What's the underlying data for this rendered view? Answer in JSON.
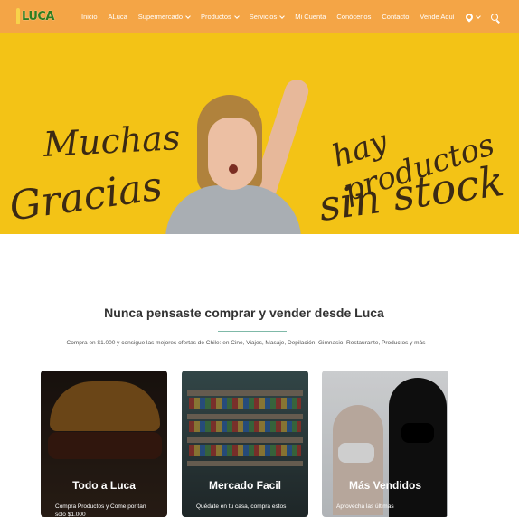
{
  "header": {
    "logo_text": "LUCA",
    "menu": [
      {
        "label": "Inicio"
      },
      {
        "label": "ALuca"
      },
      {
        "label": "Supermercado"
      },
      {
        "label": "Productos"
      },
      {
        "label": "Servicios"
      },
      {
        "label": "Mi Cuenta"
      },
      {
        "label": "Conócenos"
      },
      {
        "label": "Contacto"
      },
      {
        "label": "Vende Aquí"
      }
    ]
  },
  "hero": {
    "line1": "Muchas",
    "line2": "Gracias",
    "line3": "hay productos",
    "line4": "sin stock"
  },
  "section": {
    "title": "Nunca pensaste comprar y vender desde Luca",
    "subtitle": "Compra en $1.000 y consigue las mejores ofertas de Chile: en Cine, Viajes, Masaje, Depilación, Gimnasio, Restaurante, Productos y más"
  },
  "cards": [
    {
      "title": "Todo a Luca",
      "text": "Compra Productos y Come por tan solo $1.000"
    },
    {
      "title": "Mercado Facil",
      "text": "Quédate en tu casa, compra estos"
    },
    {
      "title": "Más Vendidos",
      "text": "Aprovecha las últimas"
    }
  ],
  "colors": {
    "nav_bg": "#f4a546",
    "hero_bg": "#f3c316",
    "logo_green": "#2f7d1f",
    "divider": "#7fb9a8"
  }
}
